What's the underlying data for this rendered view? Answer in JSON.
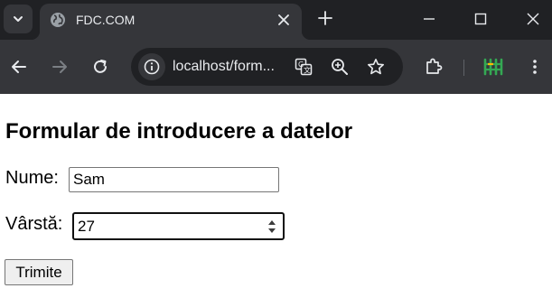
{
  "browser": {
    "tab": {
      "title": "FDC.COM"
    },
    "address_bar": {
      "url": "localhost/form..."
    },
    "icons": {
      "tab_search": "chevron-down-icon",
      "favicon": "globe-icon",
      "tab_close": "close-icon",
      "new_tab": "plus-icon",
      "minimize": "minimize-icon",
      "maximize": "maximize-icon",
      "window_close": "close-icon",
      "back": "arrow-left-icon",
      "forward": "arrow-right-icon",
      "reload": "reload-icon",
      "site_info": "info-icon",
      "translate": "translate-icon",
      "zoom": "zoom-icon",
      "bookmark": "star-icon",
      "extensions": "puzzle-icon",
      "extension_pinned": "extension-icon",
      "menu": "kebab-menu-icon"
    },
    "colors": {
      "tabstrip_bg": "#202124",
      "toolbar_bg": "#35363a",
      "omnibox_bg": "#202124",
      "extension_accent": "#34a853"
    }
  },
  "page": {
    "title": "Formular de introducere a datelor",
    "form": {
      "name_label": "Nume:",
      "name_value": "Sam",
      "age_label": "Vârstă:",
      "age_value": "27",
      "submit_label": "Trimite"
    }
  }
}
